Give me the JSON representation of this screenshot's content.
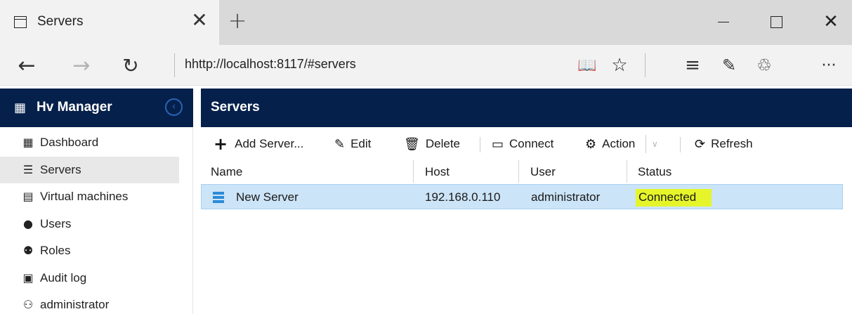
{
  "browser": {
    "tab_title": "Servers",
    "tab_close_glyph": "✕",
    "new_tab_glyph": "+",
    "address": "hhttp://localhost:8117/#servers",
    "icons": {
      "back": "←",
      "forward": "→",
      "refresh": "↻",
      "reading_view": "📖",
      "favorite": "☆",
      "hub": "≡",
      "web_note": "✎",
      "share": "♲",
      "more": "···",
      "minimize": "",
      "maximize": "",
      "close": "✕"
    }
  },
  "sidebar": {
    "title": "Hv Manager",
    "logo_glyph": "▦",
    "collapse_glyph": "‹",
    "items": [
      {
        "label": "Dashboard",
        "icon": "dashboard-icon",
        "glyph": "▦",
        "active": false
      },
      {
        "label": "Servers",
        "icon": "server-icon",
        "glyph": "☰",
        "active": true
      },
      {
        "label": "Virtual machines",
        "icon": "virtual-machine-icon",
        "glyph": "▤",
        "active": false
      },
      {
        "label": "Users",
        "icon": "user-icon",
        "glyph": "●",
        "active": false
      },
      {
        "label": "Roles",
        "icon": "roles-icon",
        "glyph": "⚉",
        "active": false
      },
      {
        "label": "Audit log",
        "icon": "audit-log-icon",
        "glyph": "▣",
        "active": false
      },
      {
        "label": "administrator",
        "icon": "admin-user-icon",
        "glyph": "⚇",
        "active": false
      }
    ]
  },
  "main": {
    "title": "Servers",
    "toolbar": {
      "add": {
        "label": "Add Server...",
        "glyph": "+"
      },
      "edit": {
        "label": "Edit",
        "glyph": "✎"
      },
      "delete": {
        "label": "Delete",
        "glyph": "🗑"
      },
      "connect": {
        "label": "Connect",
        "glyph": "▭"
      },
      "action": {
        "label": "Action",
        "glyph": "⚙"
      },
      "action_dropdown_glyph": "∨",
      "refresh": {
        "label": "Refresh",
        "glyph": "⟳"
      }
    },
    "table": {
      "columns": [
        "Name",
        "Host",
        "User",
        "Status"
      ],
      "rows": [
        {
          "name": "New Server",
          "host": "192.168.0.110",
          "user": "administrator",
          "status": "Connected",
          "selected": true
        }
      ]
    }
  },
  "colors": {
    "header_bg": "#05204b",
    "selected_row": "#cce4f7",
    "status_highlight": "#e6f52a"
  }
}
